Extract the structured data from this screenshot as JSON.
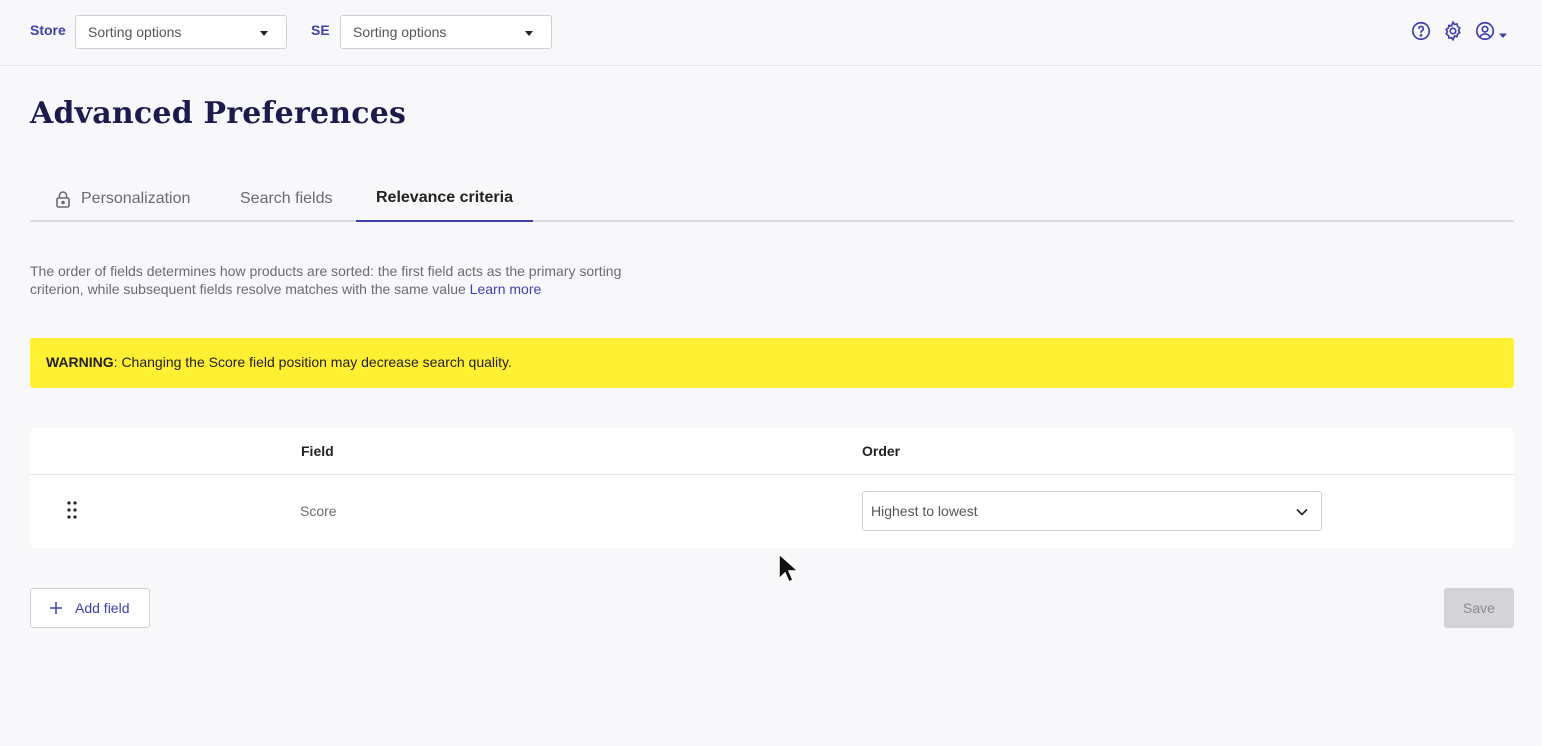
{
  "topbar": {
    "store_label": "Store",
    "store_select": "Sorting options",
    "se_label": "SE",
    "se_select": "Sorting options",
    "icons": [
      "help-circle-icon",
      "gear-icon",
      "user-circle-icon",
      "caret-down-icon"
    ]
  },
  "page": {
    "title": "Advanced Preferences"
  },
  "tabs": [
    {
      "label": "Personalization",
      "locked": true,
      "active": false
    },
    {
      "label": "Search fields",
      "active": false
    },
    {
      "label": "Relevance criteria",
      "active": true
    }
  ],
  "description": {
    "line1": "The order of fields determines how products are sorted: the first field acts as the primary sorting",
    "line2": "criterion, while subsequent fields resolve matches with the same value",
    "link": "Learn more"
  },
  "warning": {
    "prefix": "WARNING",
    "text": ": Changing the Score field position may decrease search quality."
  },
  "table": {
    "headers": {
      "field": "Field",
      "order": "Order"
    },
    "rows": [
      {
        "field": "Score",
        "order": "Highest to lowest"
      }
    ]
  },
  "actions": {
    "add_field": "Add field",
    "save": "Save"
  },
  "colors": {
    "accent": "#3f3fa8",
    "title": "#1d1b4e",
    "warning_bg": "#fff033",
    "disabled_bg": "#d4d4d8"
  }
}
